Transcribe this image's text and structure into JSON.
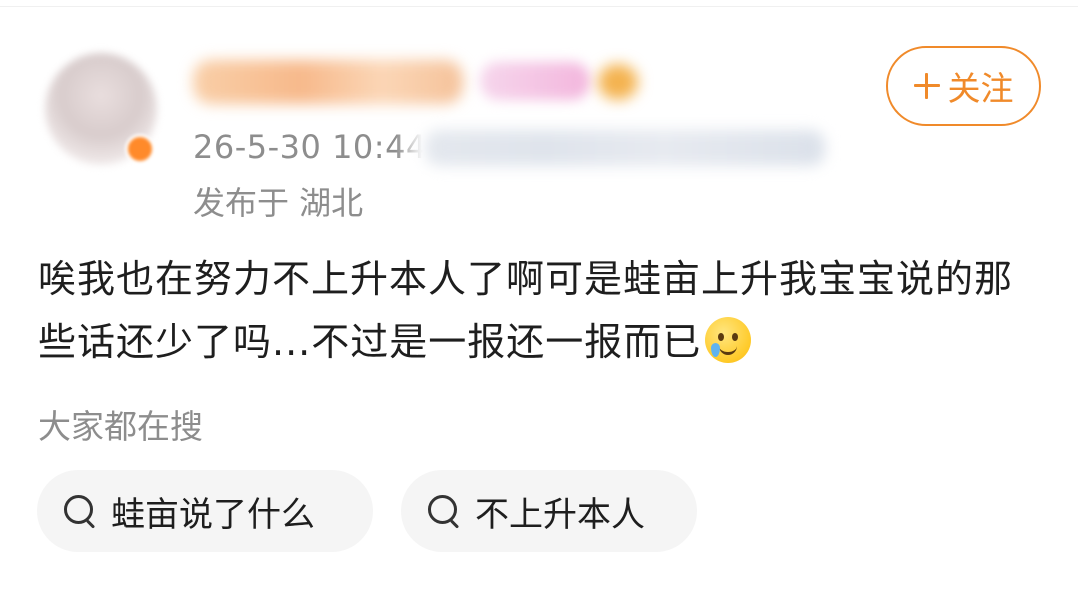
{
  "post": {
    "author": {
      "avatar": "blurred-avatar",
      "name_blurred": true,
      "vip_badge_blurred": true
    },
    "timestamp": "26-5-30 10:44",
    "source_blurred": true,
    "location": "发布于 湖北",
    "follow_button": "十关注",
    "text": "唉我也在努力不上升本人了啊可是蛙亩上升我宝宝说的那些话还少了吗...不过是一报还一报而已",
    "emoji": "smiling-face-with-tear-icon"
  },
  "trending": {
    "label": "大家都在搜",
    "items": [
      {
        "label": "蛙亩说了什么",
        "icon": "search-icon"
      },
      {
        "label": "不上升本人",
        "icon": "search-icon"
      }
    ]
  },
  "colors": {
    "accent": "#f08a2a",
    "secondary_text": "#8d8d8d",
    "chip_background": "#f5f5f5"
  }
}
